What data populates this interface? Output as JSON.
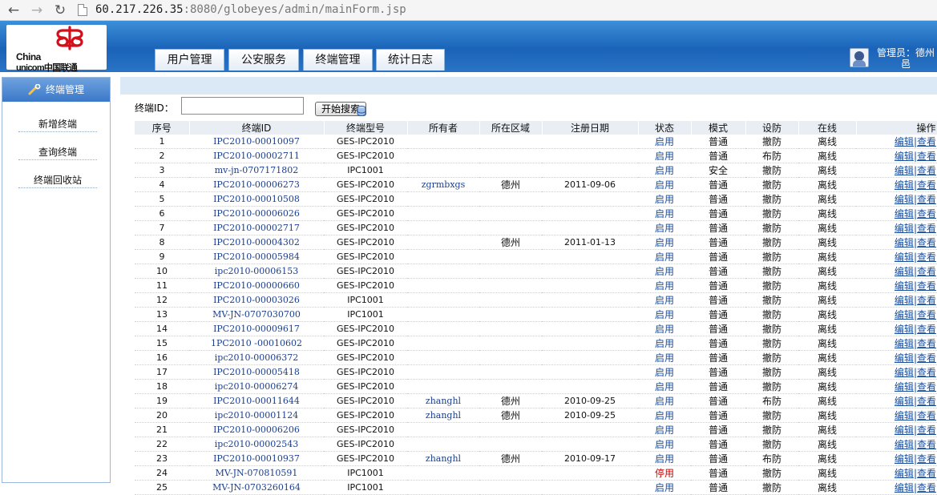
{
  "browser": {
    "url_host": "60.217.226.35",
    "url_rest": ":8080/globeyes/admin/mainForm.jsp"
  },
  "header": {
    "logo_line1": "China",
    "logo_line2": "unicom中国联通",
    "tabs": [
      "用户管理",
      "公安服务",
      "终端管理",
      "统计日志"
    ],
    "admin_label": "管理员：德州邑"
  },
  "sidebar": {
    "title": "终端管理",
    "items": [
      "新增终端",
      "查询终端",
      "终端回收站"
    ]
  },
  "search": {
    "label": "终端ID：",
    "value": "",
    "button": "开始搜索"
  },
  "table": {
    "columns": [
      "序号",
      "终端ID",
      "终端型号",
      "所有者",
      "所在区域",
      "注册日期",
      "状态",
      "模式",
      "设防",
      "在线",
      "操作"
    ],
    "edit_label": "编辑",
    "separator": "|",
    "view_label": "查看",
    "rows": [
      {
        "no": "1",
        "id": "IPC2010-00010097",
        "model": "GES-IPC2010",
        "owner": "",
        "region": "",
        "date": "",
        "status": "启用",
        "mode": "普通",
        "armed": "撤防",
        "online": "离线"
      },
      {
        "no": "2",
        "id": "IPC2010-00002711",
        "model": "GES-IPC2010",
        "owner": "",
        "region": "",
        "date": "",
        "status": "启用",
        "mode": "普通",
        "armed": "布防",
        "online": "离线"
      },
      {
        "no": "3",
        "id": "mv-jn-0707171802",
        "model": "IPC1001",
        "owner": "",
        "region": "",
        "date": "",
        "status": "启用",
        "mode": "安全",
        "armed": "撤防",
        "online": "离线"
      },
      {
        "no": "4",
        "id": "IPC2010-00006273",
        "model": "GES-IPC2010",
        "owner": "zgrmbxgs",
        "region": "德州",
        "date": "2011-09-06",
        "status": "启用",
        "mode": "普通",
        "armed": "撤防",
        "online": "离线"
      },
      {
        "no": "5",
        "id": "IPC2010-00010508",
        "model": "GES-IPC2010",
        "owner": "",
        "region": "",
        "date": "",
        "status": "启用",
        "mode": "普通",
        "armed": "撤防",
        "online": "离线"
      },
      {
        "no": "6",
        "id": "IPC2010-00006026",
        "model": "GES-IPC2010",
        "owner": "",
        "region": "",
        "date": "",
        "status": "启用",
        "mode": "普通",
        "armed": "撤防",
        "online": "离线"
      },
      {
        "no": "7",
        "id": "IPC2010-00002717",
        "model": "GES-IPC2010",
        "owner": "",
        "region": "",
        "date": "",
        "status": "启用",
        "mode": "普通",
        "armed": "撤防",
        "online": "离线"
      },
      {
        "no": "8",
        "id": "IPC2010-00004302",
        "model": "GES-IPC2010",
        "owner": "",
        "region": "德州",
        "date": "2011-01-13",
        "status": "启用",
        "mode": "普通",
        "armed": "撤防",
        "online": "离线"
      },
      {
        "no": "9",
        "id": "IPC2010-00005984",
        "model": "GES-IPC2010",
        "owner": "",
        "region": "",
        "date": "",
        "status": "启用",
        "mode": "普通",
        "armed": "撤防",
        "online": "离线"
      },
      {
        "no": "10",
        "id": "ipc2010-00006153",
        "model": "GES-IPC2010",
        "owner": "",
        "region": "",
        "date": "",
        "status": "启用",
        "mode": "普通",
        "armed": "撤防",
        "online": "离线"
      },
      {
        "no": "11",
        "id": "IPC2010-00000660",
        "model": "GES-IPC2010",
        "owner": "",
        "region": "",
        "date": "",
        "status": "启用",
        "mode": "普通",
        "armed": "撤防",
        "online": "离线"
      },
      {
        "no": "12",
        "id": "IPC2010-00003026",
        "model": "IPC1001",
        "owner": "",
        "region": "",
        "date": "",
        "status": "启用",
        "mode": "普通",
        "armed": "撤防",
        "online": "离线"
      },
      {
        "no": "13",
        "id": "MV-JN-0707030700",
        "model": "IPC1001",
        "owner": "",
        "region": "",
        "date": "",
        "status": "启用",
        "mode": "普通",
        "armed": "撤防",
        "online": "离线"
      },
      {
        "no": "14",
        "id": "IPC2010-00009617",
        "model": "GES-IPC2010",
        "owner": "",
        "region": "",
        "date": "",
        "status": "启用",
        "mode": "普通",
        "armed": "撤防",
        "online": "离线"
      },
      {
        "no": "15",
        "id": "1PC2010 -00010602",
        "model": "GES-IPC2010",
        "owner": "",
        "region": "",
        "date": "",
        "status": "启用",
        "mode": "普通",
        "armed": "撤防",
        "online": "离线"
      },
      {
        "no": "16",
        "id": "ipc2010-00006372",
        "model": "GES-IPC2010",
        "owner": "",
        "region": "",
        "date": "",
        "status": "启用",
        "mode": "普通",
        "armed": "撤防",
        "online": "离线"
      },
      {
        "no": "17",
        "id": "IPC2010-00005418",
        "model": "GES-IPC2010",
        "owner": "",
        "region": "",
        "date": "",
        "status": "启用",
        "mode": "普通",
        "armed": "撤防",
        "online": "离线"
      },
      {
        "no": "18",
        "id": "ipc2010-00006274",
        "model": "GES-IPC2010",
        "owner": "",
        "region": "",
        "date": "",
        "status": "启用",
        "mode": "普通",
        "armed": "撤防",
        "online": "离线"
      },
      {
        "no": "19",
        "id": "IPC2010-00011644",
        "model": "GES-IPC2010",
        "owner": "zhanghl",
        "region": "德州",
        "date": "2010-09-25",
        "status": "启用",
        "mode": "普通",
        "armed": "布防",
        "online": "离线"
      },
      {
        "no": "20",
        "id": "ipc2010-00001124",
        "model": "GES-IPC2010",
        "owner": "zhanghl",
        "region": "德州",
        "date": "2010-09-25",
        "status": "启用",
        "mode": "普通",
        "armed": "撤防",
        "online": "离线"
      },
      {
        "no": "21",
        "id": "IPC2010-00006206",
        "model": "GES-IPC2010",
        "owner": "",
        "region": "",
        "date": "",
        "status": "启用",
        "mode": "普通",
        "armed": "撤防",
        "online": "离线"
      },
      {
        "no": "22",
        "id": "ipc2010-00002543",
        "model": "GES-IPC2010",
        "owner": "",
        "region": "",
        "date": "",
        "status": "启用",
        "mode": "普通",
        "armed": "撤防",
        "online": "离线"
      },
      {
        "no": "23",
        "id": "IPC2010-00010937",
        "model": "GES-IPC2010",
        "owner": "zhanghl",
        "region": "德州",
        "date": "2010-09-17",
        "status": "启用",
        "mode": "普通",
        "armed": "布防",
        "online": "离线"
      },
      {
        "no": "24",
        "id": "MV-JN-070810591",
        "model": "IPC1001",
        "owner": "",
        "region": "",
        "date": "",
        "status": "停用",
        "mode": "普通",
        "armed": "撤防",
        "online": "离线"
      },
      {
        "no": "25",
        "id": "MV-JN-0703260164",
        "model": "IPC1001",
        "owner": "",
        "region": "",
        "date": "",
        "status": "启用",
        "mode": "普通",
        "armed": "撤防",
        "online": "离线"
      }
    ]
  },
  "colors": {
    "header_blue": "#1a63b8",
    "link_blue": "#1a4fa0",
    "disabled_red": "#cc0000",
    "logo_red": "#d40f1c"
  }
}
